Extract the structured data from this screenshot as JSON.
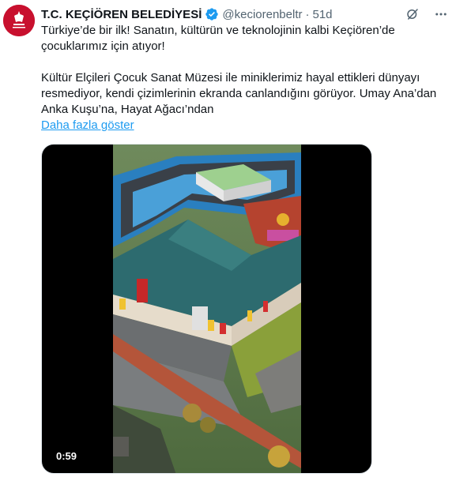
{
  "tweet": {
    "author_name": "T.C. KEÇİÖREN BELEDİYESİ",
    "handle": "@keciorenbeltr",
    "separator": "·",
    "time": "51d",
    "paragraph1": "Türkiye’de bir ilk! Sanatın, kültürün ve teknolojinin kalbi Keçiören’de çocuklarımız için atıyor!",
    "paragraph2": "Kültür Elçileri Çocuk Sanat Müzesi ile miniklerimiz hayal ettikleri dünyayı resmediyor, kendi çizimlerinin ekranda canlandığını görüyor. Umay Ana’dan Anka Kuşu’na, Hayat Ağacı’ndan",
    "show_more": "Daha fazla göster"
  },
  "media": {
    "duration": "0:59"
  },
  "icons": {
    "verified": "verified-badge-icon",
    "grok": "grok-icon",
    "more": "more-options-icon"
  },
  "colors": {
    "accent": "#1d9bf0",
    "avatar_bg": "#c8102e",
    "text": "#0f1419",
    "secondary": "#536471"
  }
}
